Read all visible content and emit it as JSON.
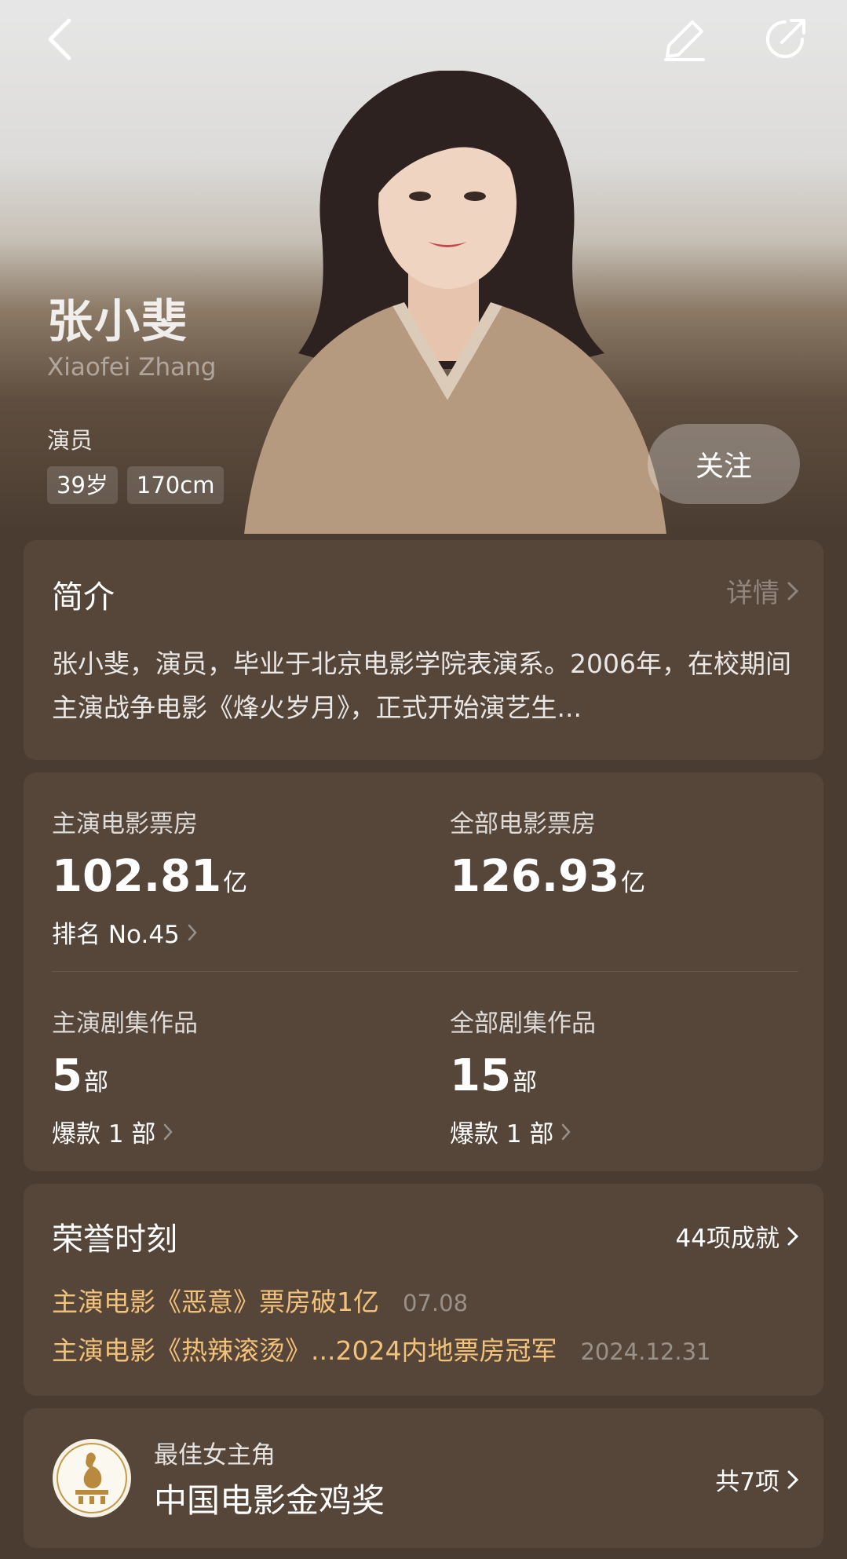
{
  "header": {
    "name_cn": "张小斐",
    "name_en": "Xiaofei Zhang",
    "role": "演员",
    "tags": [
      "39岁",
      "170cm"
    ],
    "follow_label": "关注"
  },
  "intro": {
    "title": "简介",
    "detail_label": "详情",
    "text": "张小斐，演员，毕业于北京电影学院表演系。2006年，在校期间主演战争电影《烽火岁月》，正式开始演艺生..."
  },
  "stats": {
    "lead_film_box": {
      "label": "主演电影票房",
      "value": "102.81",
      "unit": "亿",
      "sub": "排名 No.45"
    },
    "all_film_box": {
      "label": "全部电影票房",
      "value": "126.93",
      "unit": "亿"
    },
    "lead_series": {
      "label": "主演剧集作品",
      "value": "5",
      "unit": "部",
      "sub": "爆款 1 部"
    },
    "all_series": {
      "label": "全部剧集作品",
      "value": "15",
      "unit": "部",
      "sub": "爆款 1 部"
    }
  },
  "honors": {
    "title": "荣誉时刻",
    "count_label": "44项成就",
    "items": [
      {
        "text": "主演电影《恶意》票房破1亿",
        "date": "07.08"
      },
      {
        "text": "主演电影《热辣滚烫》...2024内地票房冠军",
        "date": "2024.12.31"
      }
    ]
  },
  "award": {
    "category": "最佳女主角",
    "name": "中国电影金鸡奖",
    "count_label": "共7项"
  },
  "colors": {
    "background": "#4a3c31",
    "card": "#56463a",
    "honor_accent": "#f2c17a"
  },
  "icons": [
    "back-arrow-icon",
    "edit-pencil-icon",
    "share-icon",
    "chevron-right-icon",
    "golden-rooster-logo"
  ]
}
